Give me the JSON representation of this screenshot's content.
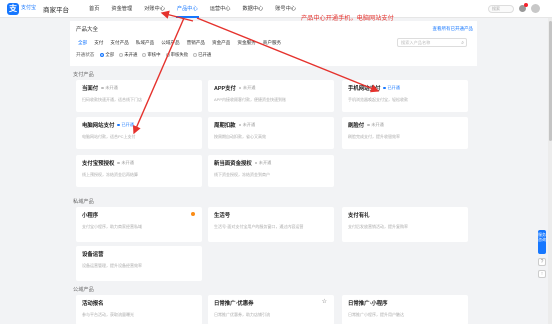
{
  "topbar": {
    "logo_mark": "支",
    "logo_text": "支付宝",
    "brand": "商家平台",
    "nav": [
      {
        "label": "首页",
        "active": false
      },
      {
        "label": "资金管理",
        "active": false
      },
      {
        "label": "对账中心",
        "active": false
      },
      {
        "label": "产品中心",
        "active": true
      },
      {
        "label": "运营中心",
        "active": false
      },
      {
        "label": "数据中心",
        "active": false
      },
      {
        "label": "账号中心",
        "active": false
      }
    ],
    "search_placeholder": "搜索"
  },
  "header": {
    "title": "产品大全",
    "annotation": "产品中心开通手机，电脑网站支付",
    "top_link": "查看所有已开通产品",
    "category_chips": [
      "全部",
      "支付",
      "支付产品",
      "私域产品",
      "公域产品",
      "营销产品",
      "资金产品",
      "资金服务",
      "商户服务"
    ],
    "status_label": "开通状态",
    "status_options": [
      {
        "label": "全部",
        "on": true
      },
      {
        "label": "未开通",
        "on": false
      },
      {
        "label": "审核中",
        "on": false
      },
      {
        "label": "审核失败",
        "on": false
      },
      {
        "label": "已开通",
        "on": false
      }
    ],
    "search_placeholder": "搜索入产品名称"
  },
  "sections": {
    "payment": "支付产品",
    "private": "私域产品",
    "public": "公域产品"
  },
  "payment_cards": [
    {
      "title": "当面付",
      "status": "未开通",
      "ok": false,
      "desc": "扫码收款快速开通，适合线下门店"
    },
    {
      "title": "APP支付",
      "status": "未开通",
      "ok": false,
      "desc": "APP内接收顾客付款，便捷资金快速到账"
    },
    {
      "title": "手机网站支付",
      "status": "已开通",
      "ok": true,
      "desc": "手机浏览器唤起支付宝，轻松收款"
    },
    {
      "title": "电脑网站支付",
      "status": "已开通",
      "ok": true,
      "desc": "电脑网站付款，适合PC上支付"
    },
    {
      "title": "周期扣款",
      "status": "未开通",
      "ok": false,
      "desc": "按周期自动扣款，省心又高效"
    },
    {
      "title": "刷脸付",
      "status": "未开通",
      "ok": false,
      "desc": "刷脸完成支付，提升收银效率"
    },
    {
      "title": "支付宝预授权",
      "status": "未开通",
      "ok": false,
      "desc": "线上预授权，冻结资金后再结算"
    },
    {
      "title": "新当面资金授权",
      "status": "未开通",
      "ok": false,
      "desc": "线下资金授权，冻结资金到商户"
    }
  ],
  "private_cards": [
    {
      "title": "小程序",
      "desc": "支付宝小程序，助力商家经营私域",
      "badge": true
    },
    {
      "title": "生活号",
      "desc": "生活号·面对支付宝用户的服务窗口，通过内容运营"
    },
    {
      "title": "支付有礼",
      "desc": "支付后发放营销活动，提升复购率"
    },
    {
      "title": "设备运营",
      "desc": "设备运营管理，提升设备经营效率"
    }
  ],
  "public_cards": [
    {
      "title": "活动报名",
      "desc": "参与平台活动，获取流量曝光"
    },
    {
      "title": "日常推广·优惠券",
      "desc": "日常推广优惠券，助力店铺引流",
      "star": true
    },
    {
      "title": "日常推广·小程序",
      "desc": "日常推广小程序，提升用户触达"
    }
  ],
  "float": {
    "tab_label": "服务咨询",
    "icon1": "?",
    "icon2": "↑"
  },
  "colors": {
    "accent": "#1677ff",
    "annotation": "#e5322d",
    "arrow": "#e5322d"
  }
}
